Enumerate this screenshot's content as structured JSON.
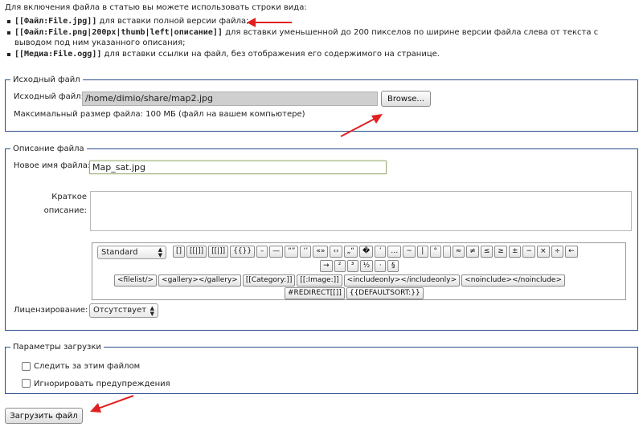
{
  "intro": "Для включения файла в статью вы можете использовать строки вида:",
  "syntax_items": [
    {
      "code": "[[Файл:File.jpg]]",
      "text": " для вставки полной версии файла;"
    },
    {
      "code": "[[Файл:File.png|200px|thumb|left|описание]]",
      "text": " для вставки уменьшенной до 200 пикселов по ширине версии файла слева от текста с выводом под ним указанного описания;"
    },
    {
      "code": "[[Медиа:File.ogg]]",
      "text": " для вставки ссылки на файл, без отображения его содержимого на странице."
    }
  ],
  "source": {
    "legend": "Исходный файл",
    "label": "Исходный файл:",
    "path": "/home/dimio/share/map2.jpg",
    "browse": "Browse...",
    "maxsize": "Максимальный размер файла: 100 МБ (файл на вашем компьютере)"
  },
  "description": {
    "legend": "Описание файла",
    "newname_label": "Новое имя файла:",
    "newname_value": "Map_sat.jpg",
    "summary_label_1": "Краткое",
    "summary_label_2": "описание:",
    "license_label": "Лицензирование:",
    "license_value": "Отсутствует"
  },
  "toolbar": {
    "charset": "Standard",
    "row1": [
      "[]",
      "[[|]]",
      "[[|]]",
      "{{}}",
      "–",
      "—",
      "“”",
      "‘’",
      "«»",
      "‹›",
      "„“",
      "�",
      "’",
      "…",
      "~",
      "|",
      "°",
      "",
      "≈",
      "≠",
      "≤",
      "≥",
      "±",
      "−",
      "×",
      "÷",
      "←"
    ],
    "row2": [
      "→",
      "²",
      "³",
      "½",
      "·",
      "§"
    ],
    "row3": [
      "<filelist/>",
      "<gallery></gallery>",
      "[[Category:]]",
      "[[:Image:]]",
      "<includeonly></includeonly>",
      "<noinclude></noinclude>"
    ],
    "row4": [
      "#REDIRECT[[]]",
      "{{DEFAULTSORT:}}"
    ]
  },
  "upload_params": {
    "legend": "Параметры загрузки",
    "watch": "Следить за этим файлом",
    "ignore": "Игнорировать предупреждения"
  },
  "submit": "Загрузить файл",
  "colors": {
    "border": "#2a4b8d",
    "arrow": "#e02020"
  }
}
